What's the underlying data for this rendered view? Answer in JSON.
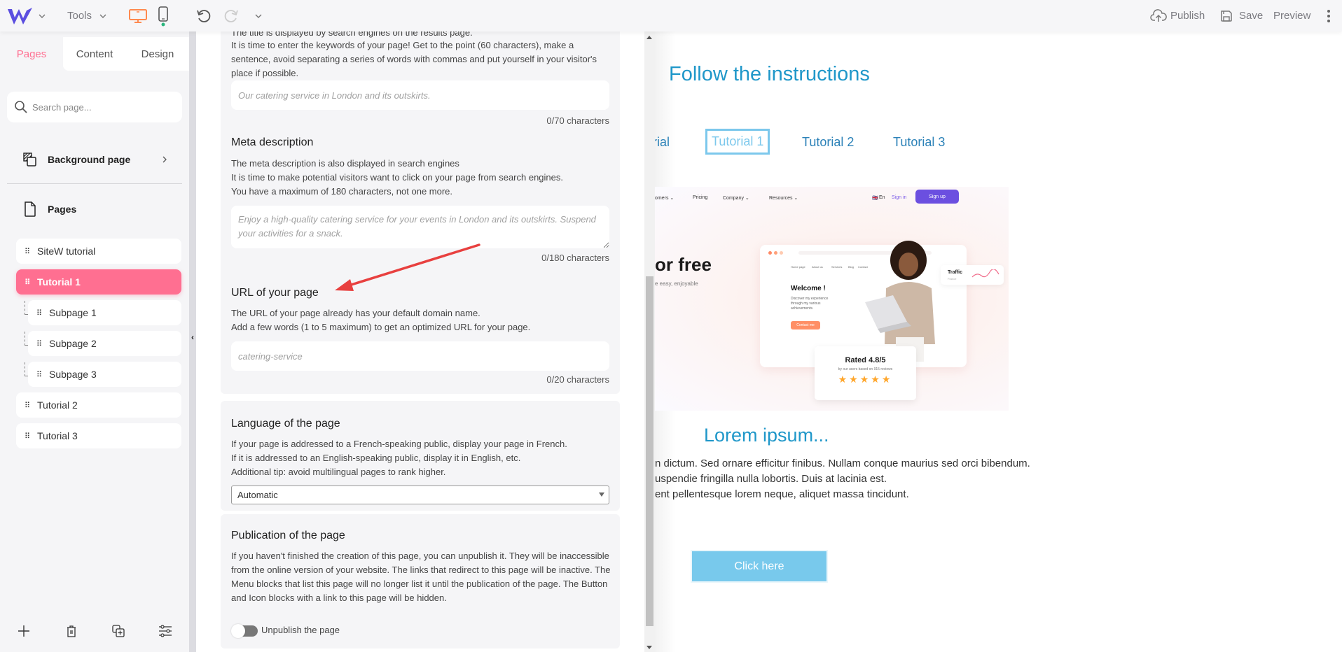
{
  "topbar": {
    "tools_label": "Tools",
    "publish_label": "Publish",
    "save_label": "Save",
    "preview_label": "Preview",
    "accent_color": "#ff8a50",
    "logo_color": "#5b4ee0"
  },
  "sidebar": {
    "tabs": [
      {
        "label": "Pages",
        "active": true
      },
      {
        "label": "Content",
        "active": false
      },
      {
        "label": "Design",
        "active": false
      }
    ],
    "search_placeholder": "Search page...",
    "background_page_label": "Background page",
    "pages_label": "Pages",
    "pages": [
      {
        "label": "SiteW tutorial",
        "level": 0,
        "active": false
      },
      {
        "label": "Tutorial 1",
        "level": 0,
        "active": true
      },
      {
        "label": "Subpage 1",
        "level": 1,
        "active": false
      },
      {
        "label": "Subpage 2",
        "level": 1,
        "active": false
      },
      {
        "label": "Subpage 3",
        "level": 1,
        "active": false
      },
      {
        "label": "Tutorial 2",
        "level": 0,
        "active": false
      },
      {
        "label": "Tutorial 3",
        "level": 0,
        "active": false
      }
    ],
    "active_color": "#ff6f91"
  },
  "seo": {
    "title_section": {
      "cut_line": "The title is displayed by search engines on the results page.",
      "description": "It is time to enter the keywords of your page! Get to the point (60 characters), make a sentence, avoid separating a series of words with commas and put yourself in your visitor's place if possible.",
      "placeholder": "Our catering service in London and its outskirts.",
      "value": "",
      "counter": "0/70 characters"
    },
    "meta_description": {
      "heading": "Meta description",
      "line1": "The meta description is also displayed in search engines",
      "line2": "It is time to make potential visitors want to click on your page from search engines.",
      "line3": "You have a maximum of 180 characters, not one more.",
      "placeholder": "Enjoy a high-quality catering service for your events in London and its outskirts. Suspend your activities for a snack.",
      "value": "",
      "counter": "0/180 characters"
    },
    "url": {
      "heading": "URL of your page",
      "line1": "The URL of your page already has your default domain name.",
      "line2": "Add a few words (1 to 5 maximum) to get an optimized URL for your page.",
      "placeholder": "catering-service",
      "value": "",
      "counter": "0/20 characters"
    },
    "language": {
      "heading": "Language of the page",
      "line1": "If your page is addressed to a French-speaking public, display your page in French.",
      "line2": "If it is addressed to an English-speaking public, display it in English, etc.",
      "line3": "Additional tip: avoid multilingual pages to rank higher.",
      "selected": "Automatic"
    },
    "publication": {
      "heading": "Publication of the page",
      "description": "If you haven't finished the creation of this page, you can unpublish it. They will be inaccessible from the online version of your website. The links that redirect to this page will be inactive. The Menu blocks that list this page will no longer list it until the publication of the page. The Button and Icon blocks with a link to this page will be hidden.",
      "toggle_label": "Unpublish the page",
      "toggle_on": false
    }
  },
  "annotation": {
    "type": "arrow",
    "color": "#e8403f",
    "points_to": "URL of your page"
  },
  "preview": {
    "title": "Follow the instructions",
    "nav": [
      {
        "label": "rial",
        "active": false
      },
      {
        "label": "Tutorial 1",
        "active": true
      },
      {
        "label": "Tutorial 2",
        "active": false
      },
      {
        "label": "Tutorial 3",
        "active": false
      }
    ],
    "hero": {
      "nav_items": [
        "omers ⌄",
        "Pricing",
        "Company ⌄",
        "Resources ⌄"
      ],
      "lang": "En",
      "signin": "Sign in",
      "signup": "Sign up",
      "headline": "or free",
      "subline": "e easy, enjoyable",
      "mock_nav": [
        "Home page",
        "About us",
        "Services",
        "Blog",
        "Contact"
      ],
      "welcome": "Welcome !",
      "welcome_text": "Discover my experience through my various achievements.",
      "contact_btn": "Contact me",
      "traffic": "Traffic",
      "traffic_sub": "France",
      "rating_title": "Rated 4.8/5",
      "rating_sub": "by our users based on 915 reviews",
      "stars": "★★★★★"
    },
    "heading": "Lorem ipsum...",
    "body_lines": [
      "n dictum. Sed ornare efficitur finibus. Nullam conque maurius sed orci bibendum.",
      "uspendie fringilla nulla lobortis. Duis at lacinia est.",
      "ent pellentesque lorem neque, aliquet massa tincidunt."
    ],
    "button_label": "Click here",
    "heading_color": "#1f97c9",
    "button_color": "#78c9ec"
  }
}
